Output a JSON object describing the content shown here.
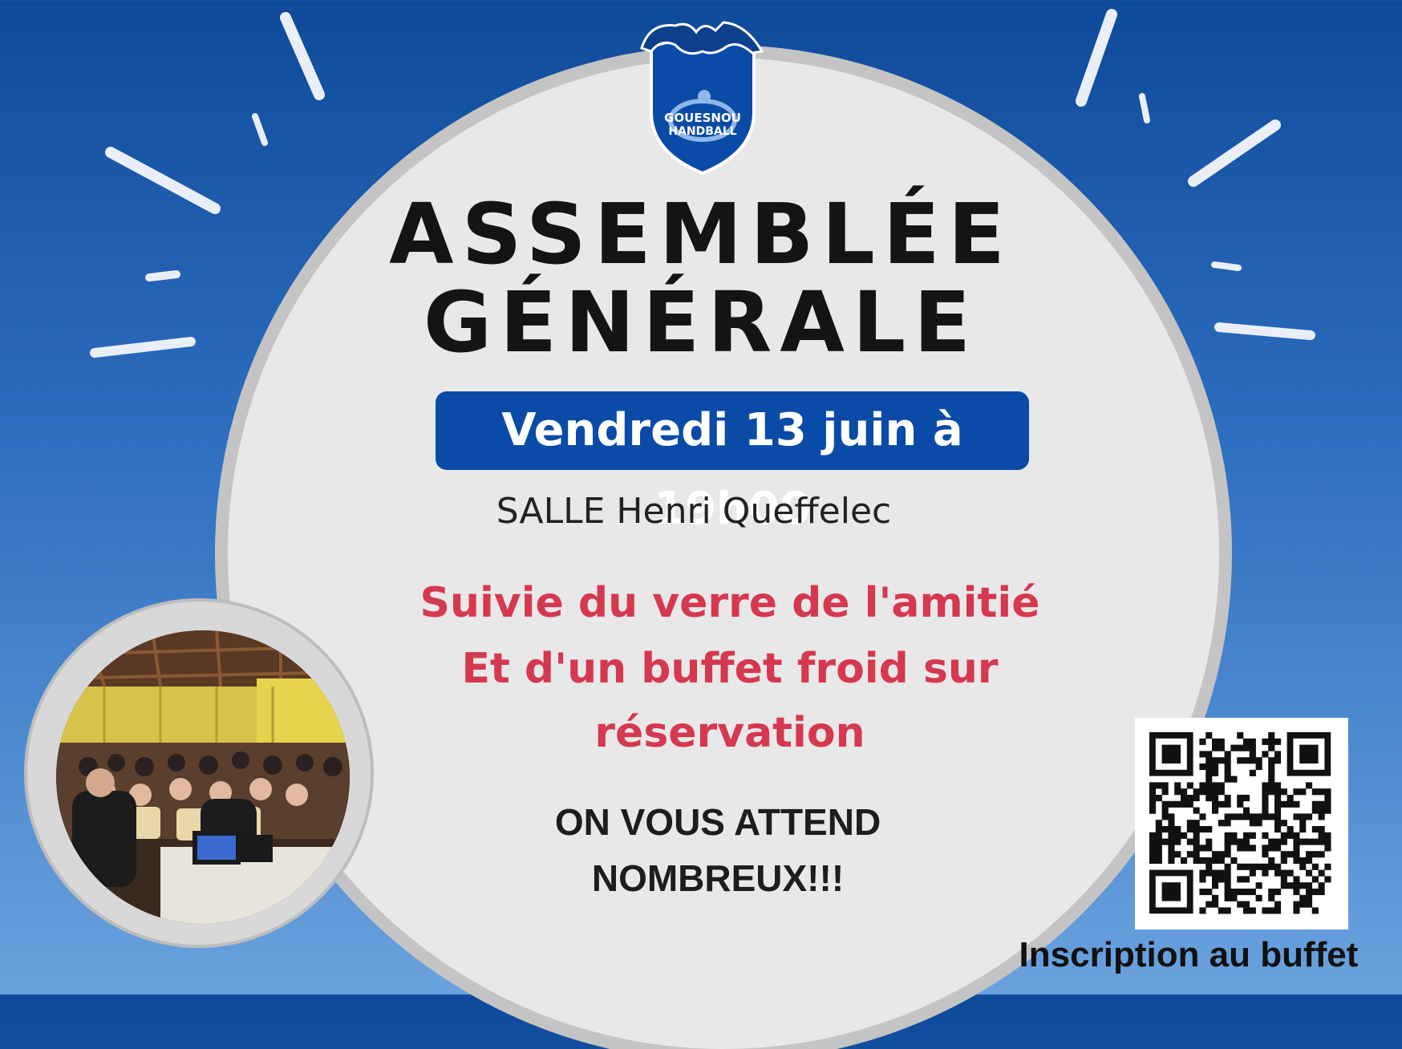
{
  "logo": {
    "line1": "GOUESNOU",
    "line2": "HANDBALL"
  },
  "title": {
    "line1": "ASSEMBLÉE",
    "line2": "GÉNÉRALE"
  },
  "date": "Vendredi 13 juin à 19h00",
  "venue": "SALLE Henri Queffelec",
  "details": [
    "Suivie du verre de l'amitié",
    "Et d'un buffet froid sur",
    "réservation"
  ],
  "call_to_action": [
    "ON VOUS ATTEND",
    "NOMBREUX!!!"
  ],
  "qr_caption": "Inscription au buffet",
  "colors": {
    "background": "#1f5fb3",
    "accent": "#0a4ba8",
    "highlight": "#d5384f",
    "circle": "#e8e8e8"
  },
  "icons": [
    "handball-club-logo",
    "qr-code",
    "meeting-photo"
  ]
}
